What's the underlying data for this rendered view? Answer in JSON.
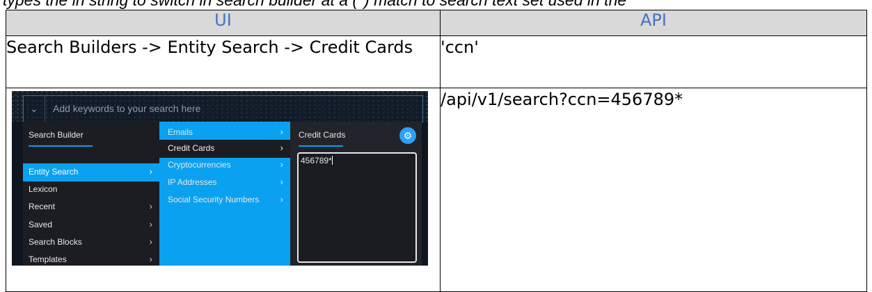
{
  "caption": "types the in string to switch in search builder at a (*) match to search text set used in the",
  "table": {
    "headers": [
      "UI",
      "API"
    ],
    "row1": {
      "ui": "Search Builders -> Entity Search -> Credit Cards",
      "api": "'ccn'"
    },
    "row2": {
      "api": "/api/v1/search?ccn=456789*"
    }
  },
  "screenshot": {
    "search_placeholder": "Add keywords to your search here",
    "builder_title": "Search Builder",
    "builder_items": [
      "Entity Search",
      "Lexicon",
      "Recent",
      "Saved",
      "Search Blocks",
      "Templates"
    ],
    "entity_items": [
      "Emails",
      "Credit Cards",
      "Cryptocurrencies",
      "IP Addresses",
      "Social Security Numbers"
    ],
    "detail_title": "Credit Cards",
    "input_value": "456789*",
    "colors": {
      "accent": "#0aa1f0",
      "header_text": "#4472c4"
    }
  }
}
